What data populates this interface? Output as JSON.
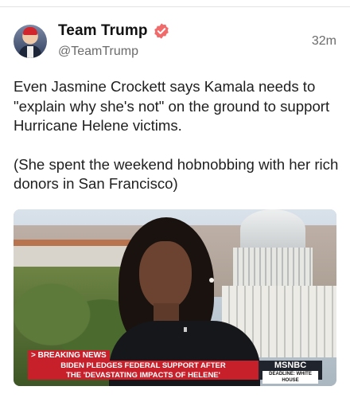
{
  "post": {
    "author": {
      "display_name": "Team Trump",
      "handle": "@TeamTrump",
      "verified_icon": "verified-badge-icon",
      "verified_color": "#f26b6b"
    },
    "timestamp": "32m",
    "text_paragraphs": [
      "Even Jasmine Crockett says Kamala needs to \"explain why she's not\" on the ground to support Hurricane Helene victims.",
      "(She spent the weekend hobnobbing with her rich donors in San Francisco)"
    ],
    "media": {
      "breaking_label": "> BREAKING NEWS",
      "headline_line1": "BIDEN PLEDGES FEDERAL SUPPORT AFTER",
      "headline_line2": "THE 'DEVASTATING IMPACTS OF HELENE'",
      "network_logo": "MSNBC",
      "network_program": "DEADLINE: WHITE HOUSE",
      "accent_color": "#c8202b"
    }
  }
}
